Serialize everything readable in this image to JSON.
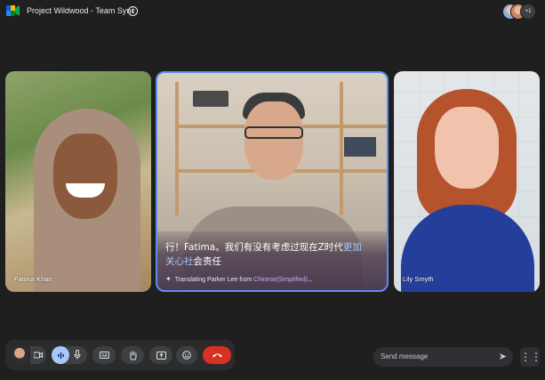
{
  "header": {
    "meeting_title": "Project Wildwood - Team Sync",
    "info_icon": "info-icon",
    "extra_participants": "+1"
  },
  "participants": [
    {
      "name": "Fatima Khan"
    },
    {
      "name": "Parker Lee"
    },
    {
      "name": "Lily Smyth"
    }
  ],
  "caption": {
    "text_main": "行！Fatima。我们有没有考虑过现在Z时代",
    "text_highlight_1": "更加",
    "text_highlight_2": "关心社",
    "text_tail": "会责任",
    "status_prefix": "Translating Parker Lee from ",
    "status_lang": "Chinese(Simplified)",
    "status_suffix": "..."
  },
  "controls": {
    "camera_icon": "camera-icon",
    "mic_icon": "mic-icon",
    "captions_icon": "captions-icon",
    "hand_icon": "raise-hand-icon",
    "present_icon": "present-icon",
    "emoji_icon": "emoji-icon",
    "end_call_icon": "end-call-icon"
  },
  "chat": {
    "placeholder": "Send message"
  },
  "colors": {
    "accent_blue": "#5b8def",
    "end_call": "#d93025",
    "background": "#1f1f1f"
  }
}
